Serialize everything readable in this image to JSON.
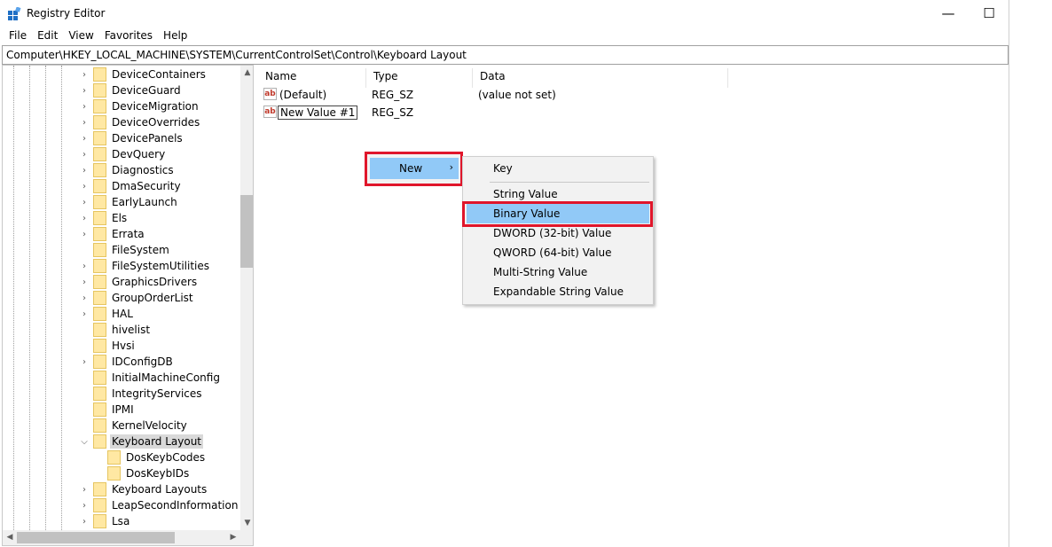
{
  "window": {
    "title": "Registry Editor",
    "minimize_glyph": "—",
    "maximize_glyph": "☐"
  },
  "menu": [
    "File",
    "Edit",
    "View",
    "Favorites",
    "Help"
  ],
  "address": "Computer\\HKEY_LOCAL_MACHINE\\SYSTEM\\CurrentControlSet\\Control\\Keyboard Layout",
  "tree": {
    "nodes": [
      {
        "label": "DeviceContainers",
        "expandable": true
      },
      {
        "label": "DeviceGuard",
        "expandable": true
      },
      {
        "label": "DeviceMigration",
        "expandable": true
      },
      {
        "label": "DeviceOverrides",
        "expandable": true
      },
      {
        "label": "DevicePanels",
        "expandable": true
      },
      {
        "label": "DevQuery",
        "expandable": true
      },
      {
        "label": "Diagnostics",
        "expandable": true
      },
      {
        "label": "DmaSecurity",
        "expandable": true
      },
      {
        "label": "EarlyLaunch",
        "expandable": true
      },
      {
        "label": "Els",
        "expandable": true
      },
      {
        "label": "Errata",
        "expandable": true
      },
      {
        "label": "FileSystem",
        "expandable": false
      },
      {
        "label": "FileSystemUtilities",
        "expandable": true
      },
      {
        "label": "GraphicsDrivers",
        "expandable": true
      },
      {
        "label": "GroupOrderList",
        "expandable": true
      },
      {
        "label": "HAL",
        "expandable": true
      },
      {
        "label": "hivelist",
        "expandable": false
      },
      {
        "label": "Hvsi",
        "expandable": false
      },
      {
        "label": "IDConfigDB",
        "expandable": true
      },
      {
        "label": "InitialMachineConfig",
        "expandable": false
      },
      {
        "label": "IntegrityServices",
        "expandable": false
      },
      {
        "label": "IPMI",
        "expandable": false
      },
      {
        "label": "KernelVelocity",
        "expandable": false
      },
      {
        "label": "Keyboard Layout",
        "expandable": true,
        "expanded": true,
        "selected": true
      },
      {
        "label": "DosKeybCodes",
        "expandable": false,
        "child": true
      },
      {
        "label": "DosKeybIDs",
        "expandable": false,
        "child": true
      },
      {
        "label": "Keyboard Layouts",
        "expandable": true
      },
      {
        "label": "LeapSecondInformation",
        "expandable": true
      },
      {
        "label": "Lsa",
        "expandable": true
      }
    ]
  },
  "list": {
    "columns": [
      "Name",
      "Type",
      "Data"
    ],
    "rows": [
      {
        "icon": "ab",
        "name": "(Default)",
        "type": "REG_SZ",
        "data": "(value not set)"
      },
      {
        "icon": "ab",
        "name": "New Value #1",
        "type": "REG_SZ",
        "data": ""
      }
    ]
  },
  "context_menu": {
    "new_label": "New",
    "submenu": [
      "Key",
      "String Value",
      "Binary Value",
      "DWORD (32-bit) Value",
      "QWORD (64-bit) Value",
      "Multi-String Value",
      "Expandable String Value"
    ],
    "active_item": "Binary Value"
  },
  "colors": {
    "highlight_border": "#e0162b",
    "menu_hover": "#91c9f7",
    "folder": "#ffe8a3"
  }
}
